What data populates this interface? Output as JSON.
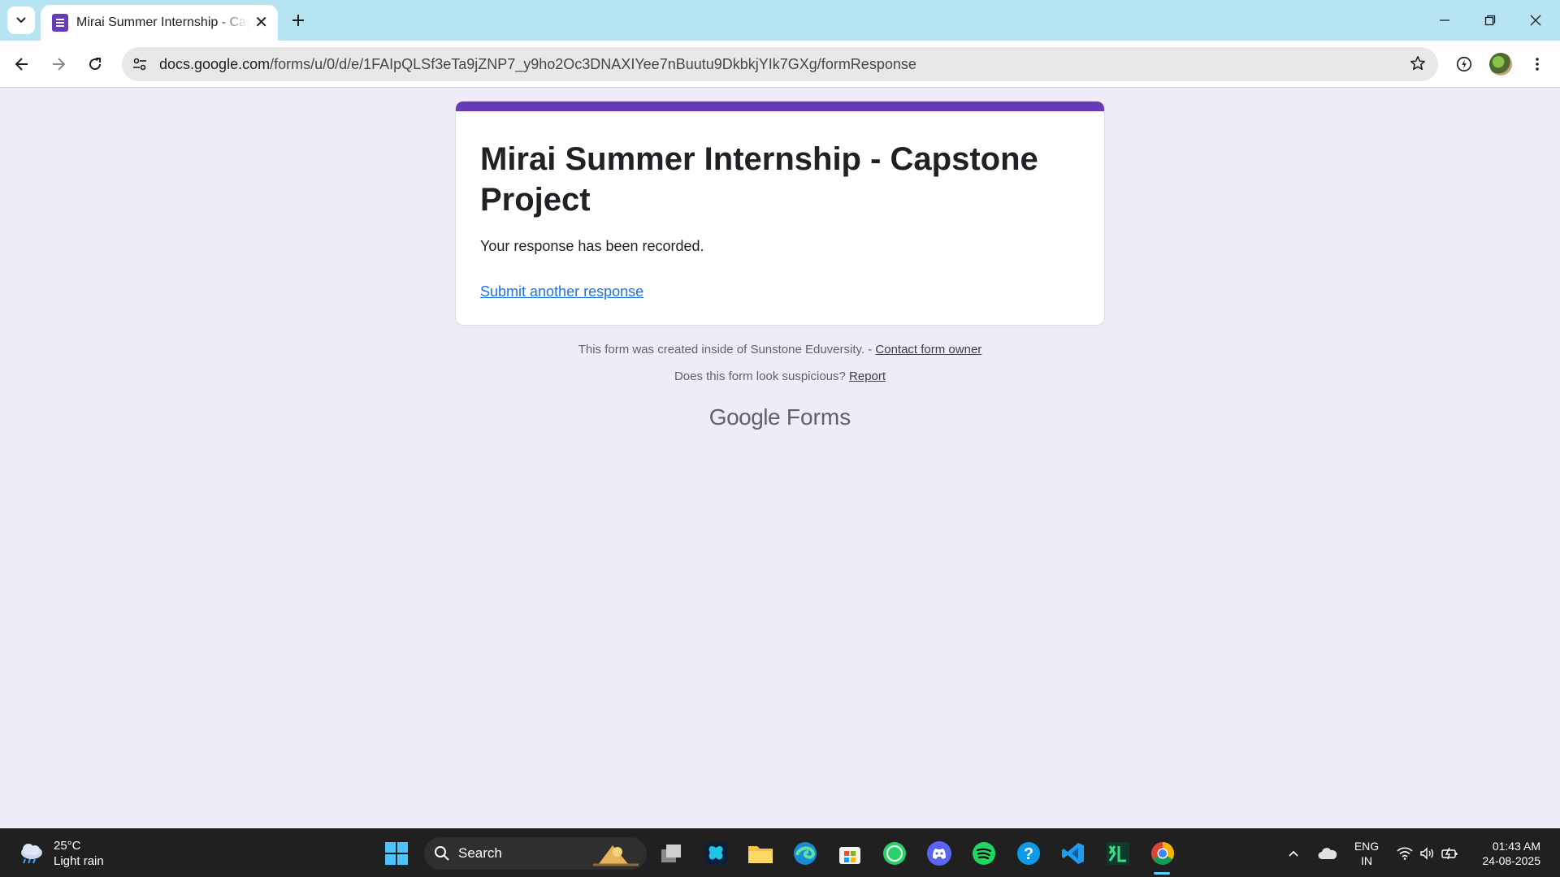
{
  "browser": {
    "tab": {
      "title": "Mirai Summer Internship - Capstone Project"
    },
    "url": {
      "host": "docs.google.com",
      "path": "/forms/u/0/d/e/1FAIpQLSf3eTa9jZNP7_y9ho2Oc3DNAXIYee7nBuutu9DkbkjYIk7GXg/formResponse"
    }
  },
  "form": {
    "accent_color": "#673ab7",
    "title": "Mirai Summer Internship - Capstone Project",
    "message": "Your response has been recorded.",
    "submit_another": "Submit another response"
  },
  "footer": {
    "created_text": "This form was created inside of Sunstone Eduversity. - ",
    "contact_link": "Contact form owner",
    "suspicious_text": "Does this form look suspicious? ",
    "report_link": "Report",
    "brand_google": "Google",
    "brand_forms": "Forms"
  },
  "taskbar": {
    "weather_temp": "25°C",
    "weather_desc": "Light rain",
    "search_label": "Search",
    "lang_line1": "ENG",
    "lang_line2": "IN",
    "time": "01:43 AM",
    "date": "24-08-2025",
    "apps": [
      "task-view",
      "app-butterfly",
      "file-explorer",
      "edge",
      "microsoft-store",
      "whatsapp",
      "discord",
      "spotify",
      "help",
      "vscode",
      "ml-app",
      "chrome"
    ]
  }
}
